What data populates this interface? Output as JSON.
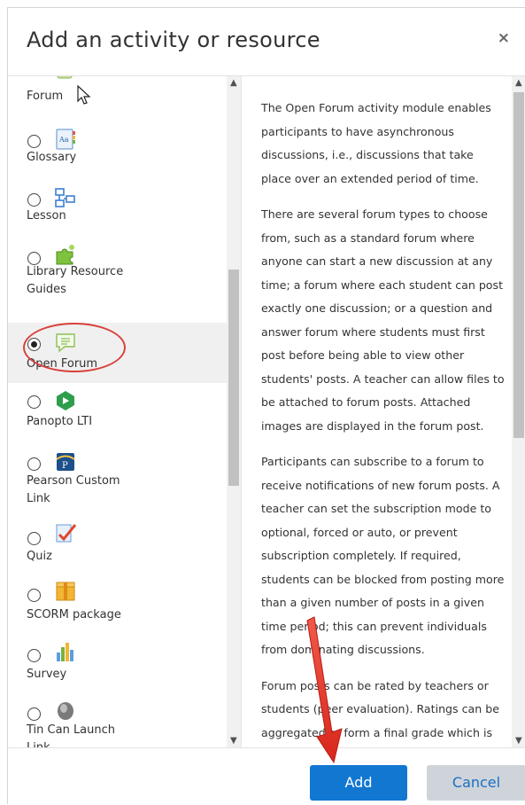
{
  "dialog": {
    "title": "Add an activity or resource",
    "close_symbol": "×"
  },
  "activities": [
    {
      "label": "Forum",
      "icon": "forum-icon",
      "selected": false
    },
    {
      "label": "Glossary",
      "icon": "glossary-icon",
      "selected": false
    },
    {
      "label": "Lesson",
      "icon": "lesson-icon",
      "selected": false
    },
    {
      "label": "Library Resource Guides",
      "icon": "puzzle-piece-icon",
      "selected": false
    },
    {
      "label": "Open Forum",
      "icon": "open-forum-icon",
      "selected": true
    },
    {
      "label": "Panopto LTI",
      "icon": "panopto-icon",
      "selected": false
    },
    {
      "label": "Pearson Custom Link",
      "icon": "pearson-icon",
      "selected": false
    },
    {
      "label": "Quiz",
      "icon": "quiz-checkmark-icon",
      "selected": false
    },
    {
      "label": "SCORM package",
      "icon": "scorm-package-icon",
      "selected": false
    },
    {
      "label": "Survey",
      "icon": "survey-bar-chart-icon",
      "selected": false
    },
    {
      "label": "Tin Can Launch Link",
      "icon": "tin-can-icon",
      "selected": false
    }
  ],
  "description": {
    "paragraphs": [
      "The Open Forum activity module enables participants to have asynchronous discussions, i.e., discussions that take place over an extended period of time.",
      "There are several forum types to choose from, such as a standard forum where anyone can start a new discussion at any time; a forum where each student can post exactly one discussion; or a question and answer forum where students must first post before being able to view other students' posts. A teacher can allow files to be attached to forum posts. Attached images are displayed in the forum post.",
      "Participants can subscribe to a forum to receive notifications of new forum posts. A teacher can set the subscription mode to optional, forced or auto, or prevent subscription completely. If required, students can be blocked from posting more than a given number of posts in a given time period; this can prevent individuals from dominating discussions.",
      "Forum posts can be rated by teachers or students (peer evaluation). Ratings can be aggregated to form a final grade which is"
    ]
  },
  "footer": {
    "add_label": "Add",
    "cancel_label": "Cancel"
  },
  "colors": {
    "primary": "#1177d1",
    "secondary": "#ced4da",
    "annotation": "#d9413b"
  }
}
